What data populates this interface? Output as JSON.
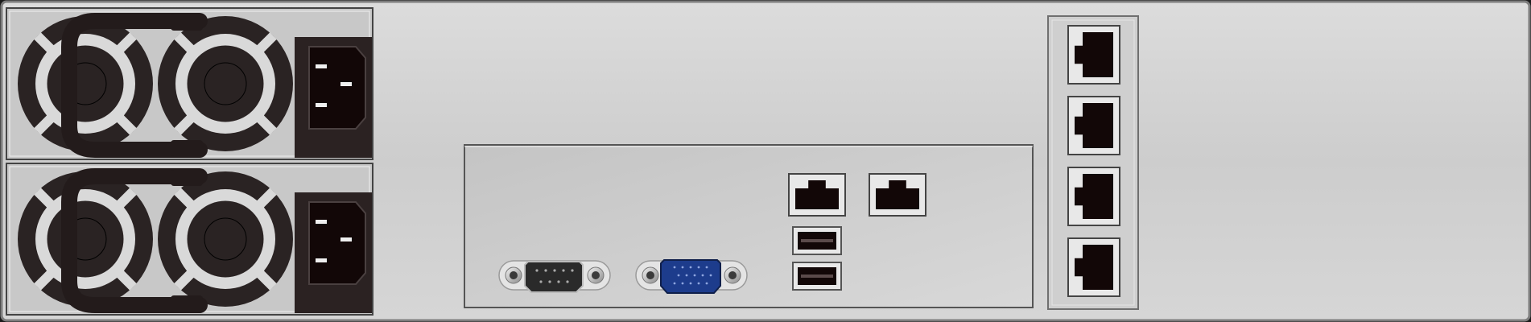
{
  "server": {
    "view": "rear-panel",
    "colors": {
      "chassis": "#cfcfcf",
      "chassis_edge": "#8c8c8c",
      "psu_body": "#c8c8c8",
      "fan_dark": "#2a2323",
      "fan_ring": "#d9d9d9",
      "handle": "#231b1b",
      "port_black": "#120707",
      "vga_blue": "#1d3c8c"
    },
    "power_supplies": [
      {
        "name": "psu-1",
        "fans": 2,
        "inlet": "C14"
      },
      {
        "name": "psu-2",
        "fans": 2,
        "inlet": "C14"
      }
    ],
    "io_panel": {
      "ports": [
        {
          "name": "serial-port-db9",
          "type": "serial"
        },
        {
          "name": "vga-port",
          "type": "vga"
        },
        {
          "name": "lan-port-1",
          "type": "rj45"
        },
        {
          "name": "lan-port-2",
          "type": "rj45"
        },
        {
          "name": "usb-port-1",
          "type": "usb-a"
        },
        {
          "name": "usb-port-2",
          "type": "usb-a"
        }
      ]
    },
    "expansion_card": {
      "ports": [
        {
          "name": "card-lan-port-1",
          "type": "rj45"
        },
        {
          "name": "card-lan-port-2",
          "type": "rj45"
        },
        {
          "name": "card-lan-port-3",
          "type": "rj45"
        },
        {
          "name": "card-lan-port-4",
          "type": "rj45"
        }
      ]
    }
  }
}
